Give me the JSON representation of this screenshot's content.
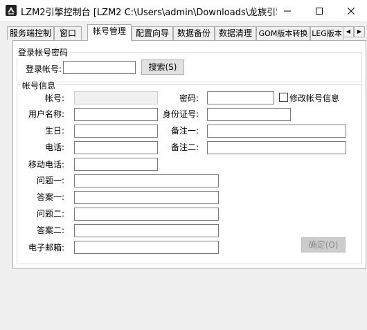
{
  "window": {
    "title": "LZM2引擎控制台 [LZM2 C:\\Users\\admin\\Downloads\\龙族引擎..."
  },
  "tabs": [
    {
      "label": "服务端控制"
    },
    {
      "label": "窗口"
    },
    {
      "label": "帐号管理"
    },
    {
      "label": "配置向导"
    },
    {
      "label": "数据备份"
    },
    {
      "label": "数据清理"
    },
    {
      "label": "GOM版本转换"
    },
    {
      "label": "LEG版本"
    }
  ],
  "login_group": {
    "title": "登录帐号密码",
    "account_label": "登录帐号:",
    "account_value": "",
    "search_button": "搜索(S)"
  },
  "info_group": {
    "title": "帐号信息",
    "account_label": "帐号:",
    "password_label": "密码:",
    "modify_checkbox": "修改帐号信息",
    "username_label": "用户名称:",
    "id_label": "身份证号:",
    "birthday_label": "生日:",
    "note1_label": "备注一:",
    "phone_label": "电话:",
    "note2_label": "备注二:",
    "mobile_label": "移动电话:",
    "question1_label": "问题一:",
    "answer1_label": "答案一:",
    "question2_label": "问题二:",
    "answer2_label": "答案二:",
    "email_label": "电子邮箱:",
    "confirm_button": "确定(O)"
  }
}
